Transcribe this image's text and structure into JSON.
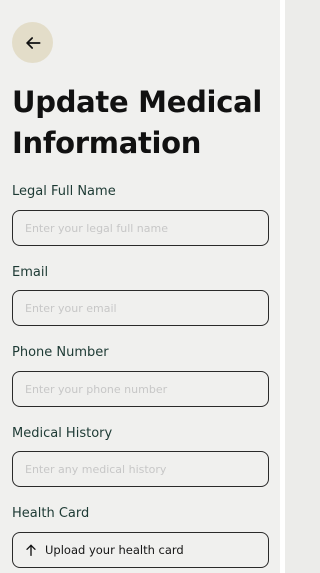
{
  "header": {
    "back_icon": "arrow-left-icon",
    "title": "Update Medical Information"
  },
  "form": {
    "name": {
      "label": "Legal Full Name",
      "placeholder": "Enter your legal full name",
      "value": ""
    },
    "email": {
      "label": "Email",
      "placeholder": "Enter your email",
      "value": ""
    },
    "phone": {
      "label": "Phone Number",
      "placeholder": "Enter your phone number",
      "value": ""
    },
    "history": {
      "label": "Medical History",
      "placeholder": "Enter any medical history",
      "value": ""
    },
    "health_card": {
      "label": "Health Card",
      "upload_label": "Upload your health card",
      "icon": "arrow-up-icon"
    }
  },
  "colors": {
    "background": "#f0f0ee",
    "back_button": "#e3ddc9",
    "label": "#1d3a34",
    "border": "#2a2a2a",
    "placeholder": "#c7c7c7"
  }
}
